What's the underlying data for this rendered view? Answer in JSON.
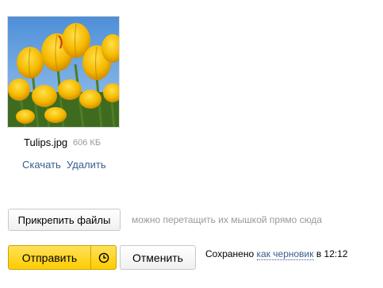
{
  "attachment": {
    "file_name": "Tulips.jpg",
    "file_size": "606 КБ",
    "download_label": "Скачать",
    "delete_label": "Удалить"
  },
  "attach_bar": {
    "attach_button_label": "Прикрепить файлы",
    "hint_text": "можно перетащить их мышкой прямо сюда"
  },
  "actions": {
    "send_label": "Отправить",
    "timer_icon": "clock-icon",
    "cancel_label": "Отменить"
  },
  "status": {
    "saved_prefix": "Сохранено",
    "draft_link": "как черновик",
    "time_suffix": "в 12:12"
  },
  "colors": {
    "send_button": "#ffcc00",
    "link": "#3a5d8c",
    "muted_text": "#999999"
  }
}
